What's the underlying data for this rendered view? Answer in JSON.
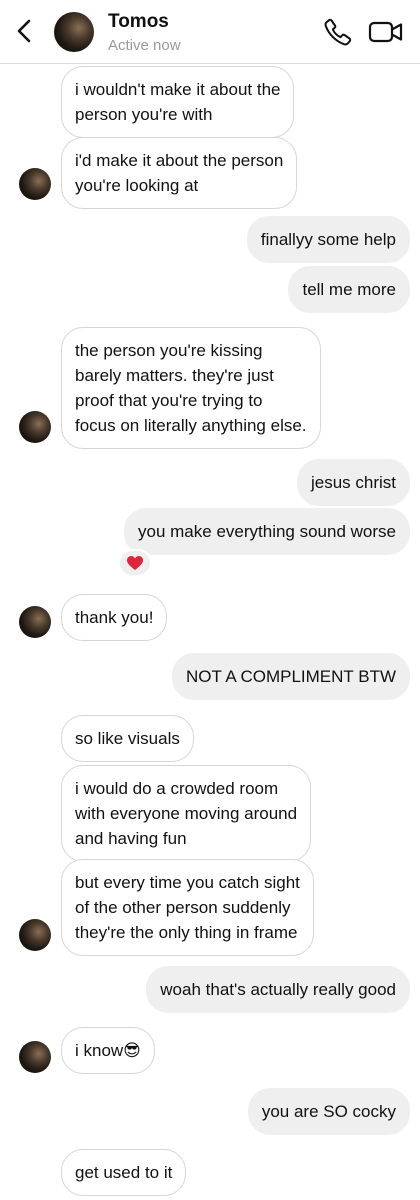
{
  "header": {
    "contact_name": "Tomos",
    "status": "Active now",
    "back_icon": "chevron-left-icon",
    "call_icon": "phone-icon",
    "video_icon": "video-camera-icon"
  },
  "messages": [
    {
      "from": "them",
      "text_lines": [
        "i wouldn't make it about the",
        "person you're with"
      ]
    },
    {
      "from": "them",
      "text_lines": [
        "i'd make it about the person",
        "you're looking at"
      ]
    },
    {
      "from": "me",
      "text_lines": [
        "finallyy some help"
      ]
    },
    {
      "from": "me",
      "text_lines": [
        "tell me more"
      ]
    },
    {
      "from": "them",
      "text_lines": [
        "the person you're kissing",
        "barely matters. they're just",
        "proof that you're trying to",
        "focus on literally anything else."
      ]
    },
    {
      "from": "me",
      "text_lines": [
        "jesus christ"
      ]
    },
    {
      "from": "me",
      "text_lines": [
        "you make everything sound worse"
      ],
      "reaction": "❤️"
    },
    {
      "from": "them",
      "text_lines": [
        "thank you!"
      ]
    },
    {
      "from": "me",
      "text_lines": [
        "NOT A COMPLIMENT BTW"
      ]
    },
    {
      "from": "them",
      "text_lines": [
        "so like visuals"
      ]
    },
    {
      "from": "them",
      "text_lines": [
        "i would do a crowded room",
        "with everyone moving around",
        "and having fun"
      ]
    },
    {
      "from": "them",
      "text_lines": [
        "but every time you catch sight",
        "of the other person suddenly",
        "they're the only thing in frame"
      ]
    },
    {
      "from": "me",
      "text_lines": [
        "woah that's actually really good"
      ]
    },
    {
      "from": "them",
      "text_lines": [
        "i know😎"
      ]
    },
    {
      "from": "me",
      "text_lines": [
        "you are SO cocky"
      ]
    },
    {
      "from": "them",
      "text_lines": [
        "get used to it"
      ]
    }
  ],
  "colors": {
    "incoming_bg": "#ffffff",
    "incoming_border": "#d6d6d6",
    "outgoing_bg": "#efefef",
    "status_text": "#9a9a9a"
  }
}
